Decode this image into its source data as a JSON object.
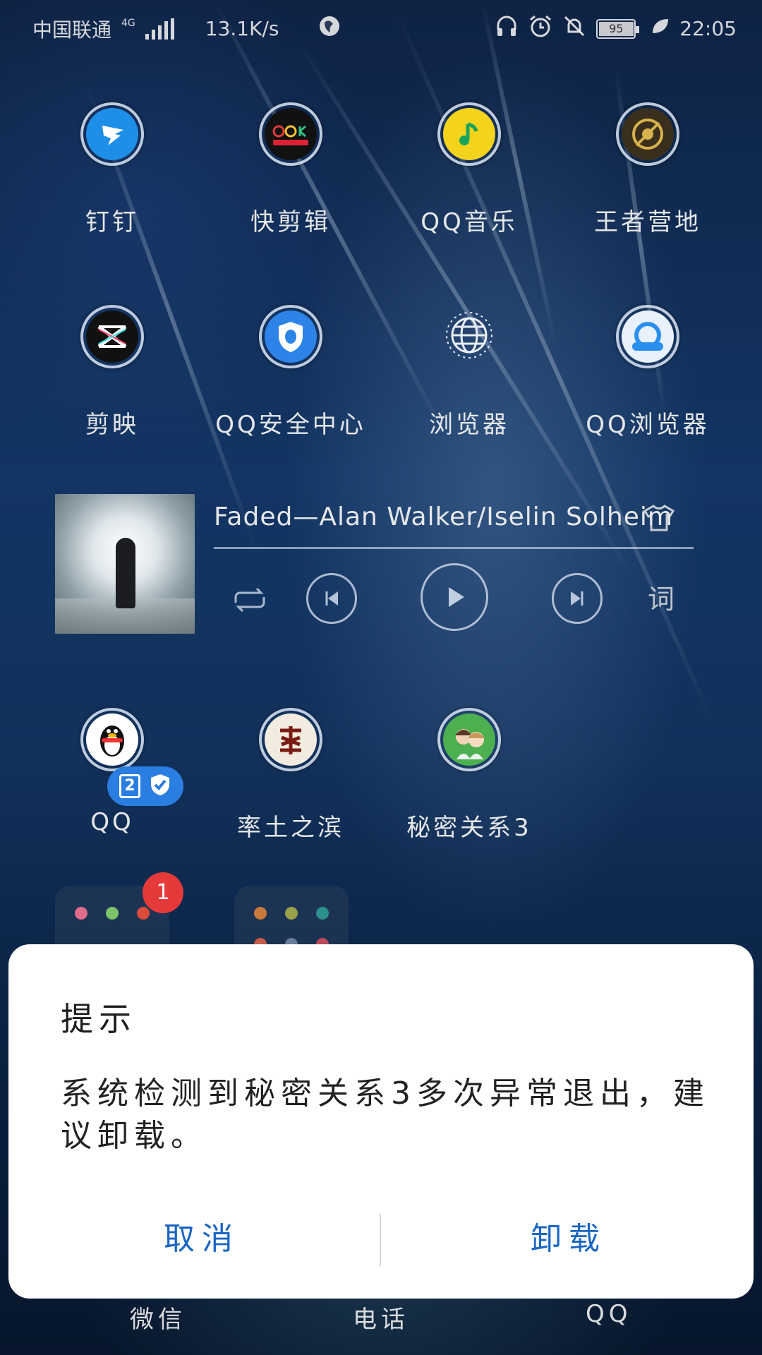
{
  "status_bar": {
    "carrier": "中国联通",
    "network_type": "4G",
    "speed": "13.1K/s",
    "battery": "95",
    "time": "22:05"
  },
  "apps": [
    {
      "label": "钉钉",
      "icon": "dingtalk-icon",
      "color": "#1e8fe8"
    },
    {
      "label": "快剪辑",
      "icon": "kuaijianji-icon",
      "color": "#111111"
    },
    {
      "label": "QQ音乐",
      "icon": "qq-music-icon",
      "color": "#f4d31c"
    },
    {
      "label": "王者营地",
      "icon": "wangzhe-camp-icon",
      "color": "#3a2f1c"
    },
    {
      "label": "剪映",
      "icon": "jianying-icon",
      "color": "#111111"
    },
    {
      "label": "QQ安全中心",
      "icon": "qq-security-icon",
      "color": "#2d83e8"
    },
    {
      "label": "浏览器",
      "icon": "browser-globe-icon",
      "color": "#00000000"
    },
    {
      "label": "QQ浏览器",
      "icon": "qq-browser-icon",
      "color": "#2b8ff0"
    },
    {
      "label": "QQ",
      "icon": "qq-penguin-icon",
      "color": "#ffffff"
    },
    {
      "label": "率土之滨",
      "icon": "shuaitu-icon",
      "color": "#f2ece0"
    },
    {
      "label": "秘密关系3",
      "icon": "secret-relation-icon",
      "color": "#4caf50"
    }
  ],
  "music_widget": {
    "song": "Faded—Alan Walker/Iselin Solheim",
    "lyrics_label": "词",
    "icons": [
      "tshirt-skin-icon",
      "repeat-icon",
      "previous-icon",
      "play-icon",
      "next-icon"
    ]
  },
  "qq_badge": {
    "count": "2"
  },
  "folder_notification": "1",
  "dock": [
    "微信",
    "电话",
    "QQ"
  ],
  "dialog": {
    "title": "提示",
    "message": "系统检测到秘密关系3多次异常退出，建议卸载。",
    "cancel_label": "取消",
    "confirm_label": "卸载",
    "accent_color": "#1b66c4"
  }
}
